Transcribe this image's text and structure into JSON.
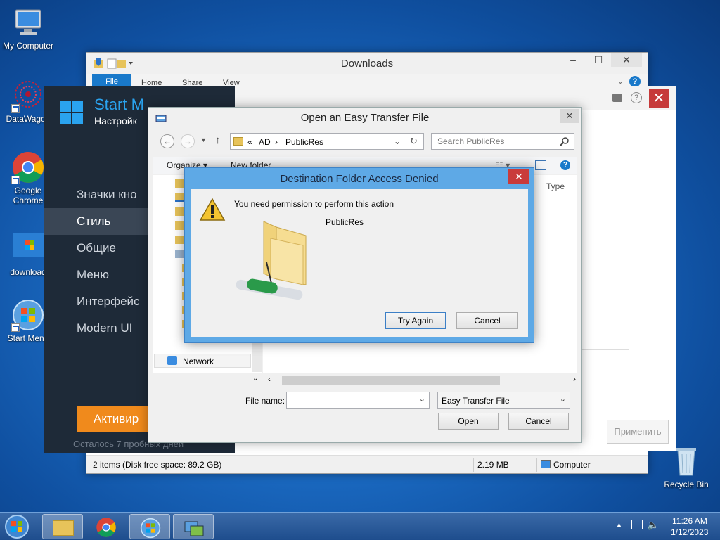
{
  "desktop": {
    "icons": [
      {
        "label": "My Computer"
      },
      {
        "label": "DataWagon"
      },
      {
        "label": "Google Chrome"
      },
      {
        "label": "download"
      },
      {
        "label": "Start Menu"
      },
      {
        "label": "Recycle Bin"
      }
    ]
  },
  "explorer": {
    "title": "Downloads",
    "tabs": [
      "File",
      "Home",
      "Share",
      "View"
    ],
    "status_items": "2 items (Disk free space: 89.2 GB)",
    "status_size": "2.19 MB",
    "status_location": "Computer"
  },
  "startapp": {
    "title": "Start M",
    "subtitle": "Настройк",
    "nav": [
      "Значки кно",
      "Стиль",
      "Общие",
      "Меню",
      "Интерфейс",
      "Modern UI"
    ],
    "active_index": 1,
    "activate_label": "Активир",
    "trial_text": "Осталось 7 пробных дней"
  },
  "settingswin": {
    "apply_label": "Применить"
  },
  "open_dialog": {
    "title": "Open an Easy Transfer File",
    "breadcrumb": [
      "«",
      "AD",
      "›",
      "PublicRes"
    ],
    "search_placeholder": "Search PublicRes",
    "organize_label": "Organize ▾",
    "new_folder_label": "New folder",
    "column_type": "Type",
    "nav_network": "Network",
    "file_name_label": "File name:",
    "file_name_value": "",
    "file_type_value": "Easy Transfer File",
    "open_label": "Open",
    "cancel_label": "Cancel"
  },
  "denied_dialog": {
    "title": "Destination Folder Access Denied",
    "message": "You need permission to perform this action",
    "folder_name": "PublicRes",
    "try_again_label": "Try Again",
    "cancel_label": "Cancel"
  },
  "taskbar": {
    "time": "11:26 AM",
    "date": "1/12/2023"
  },
  "colors": {
    "accent": "#1979ca",
    "startapp_bg": "#1e2a38",
    "activate": "#f08a1c",
    "dialog_frame": "#5ea9e6",
    "close_red": "#c93b3b"
  }
}
